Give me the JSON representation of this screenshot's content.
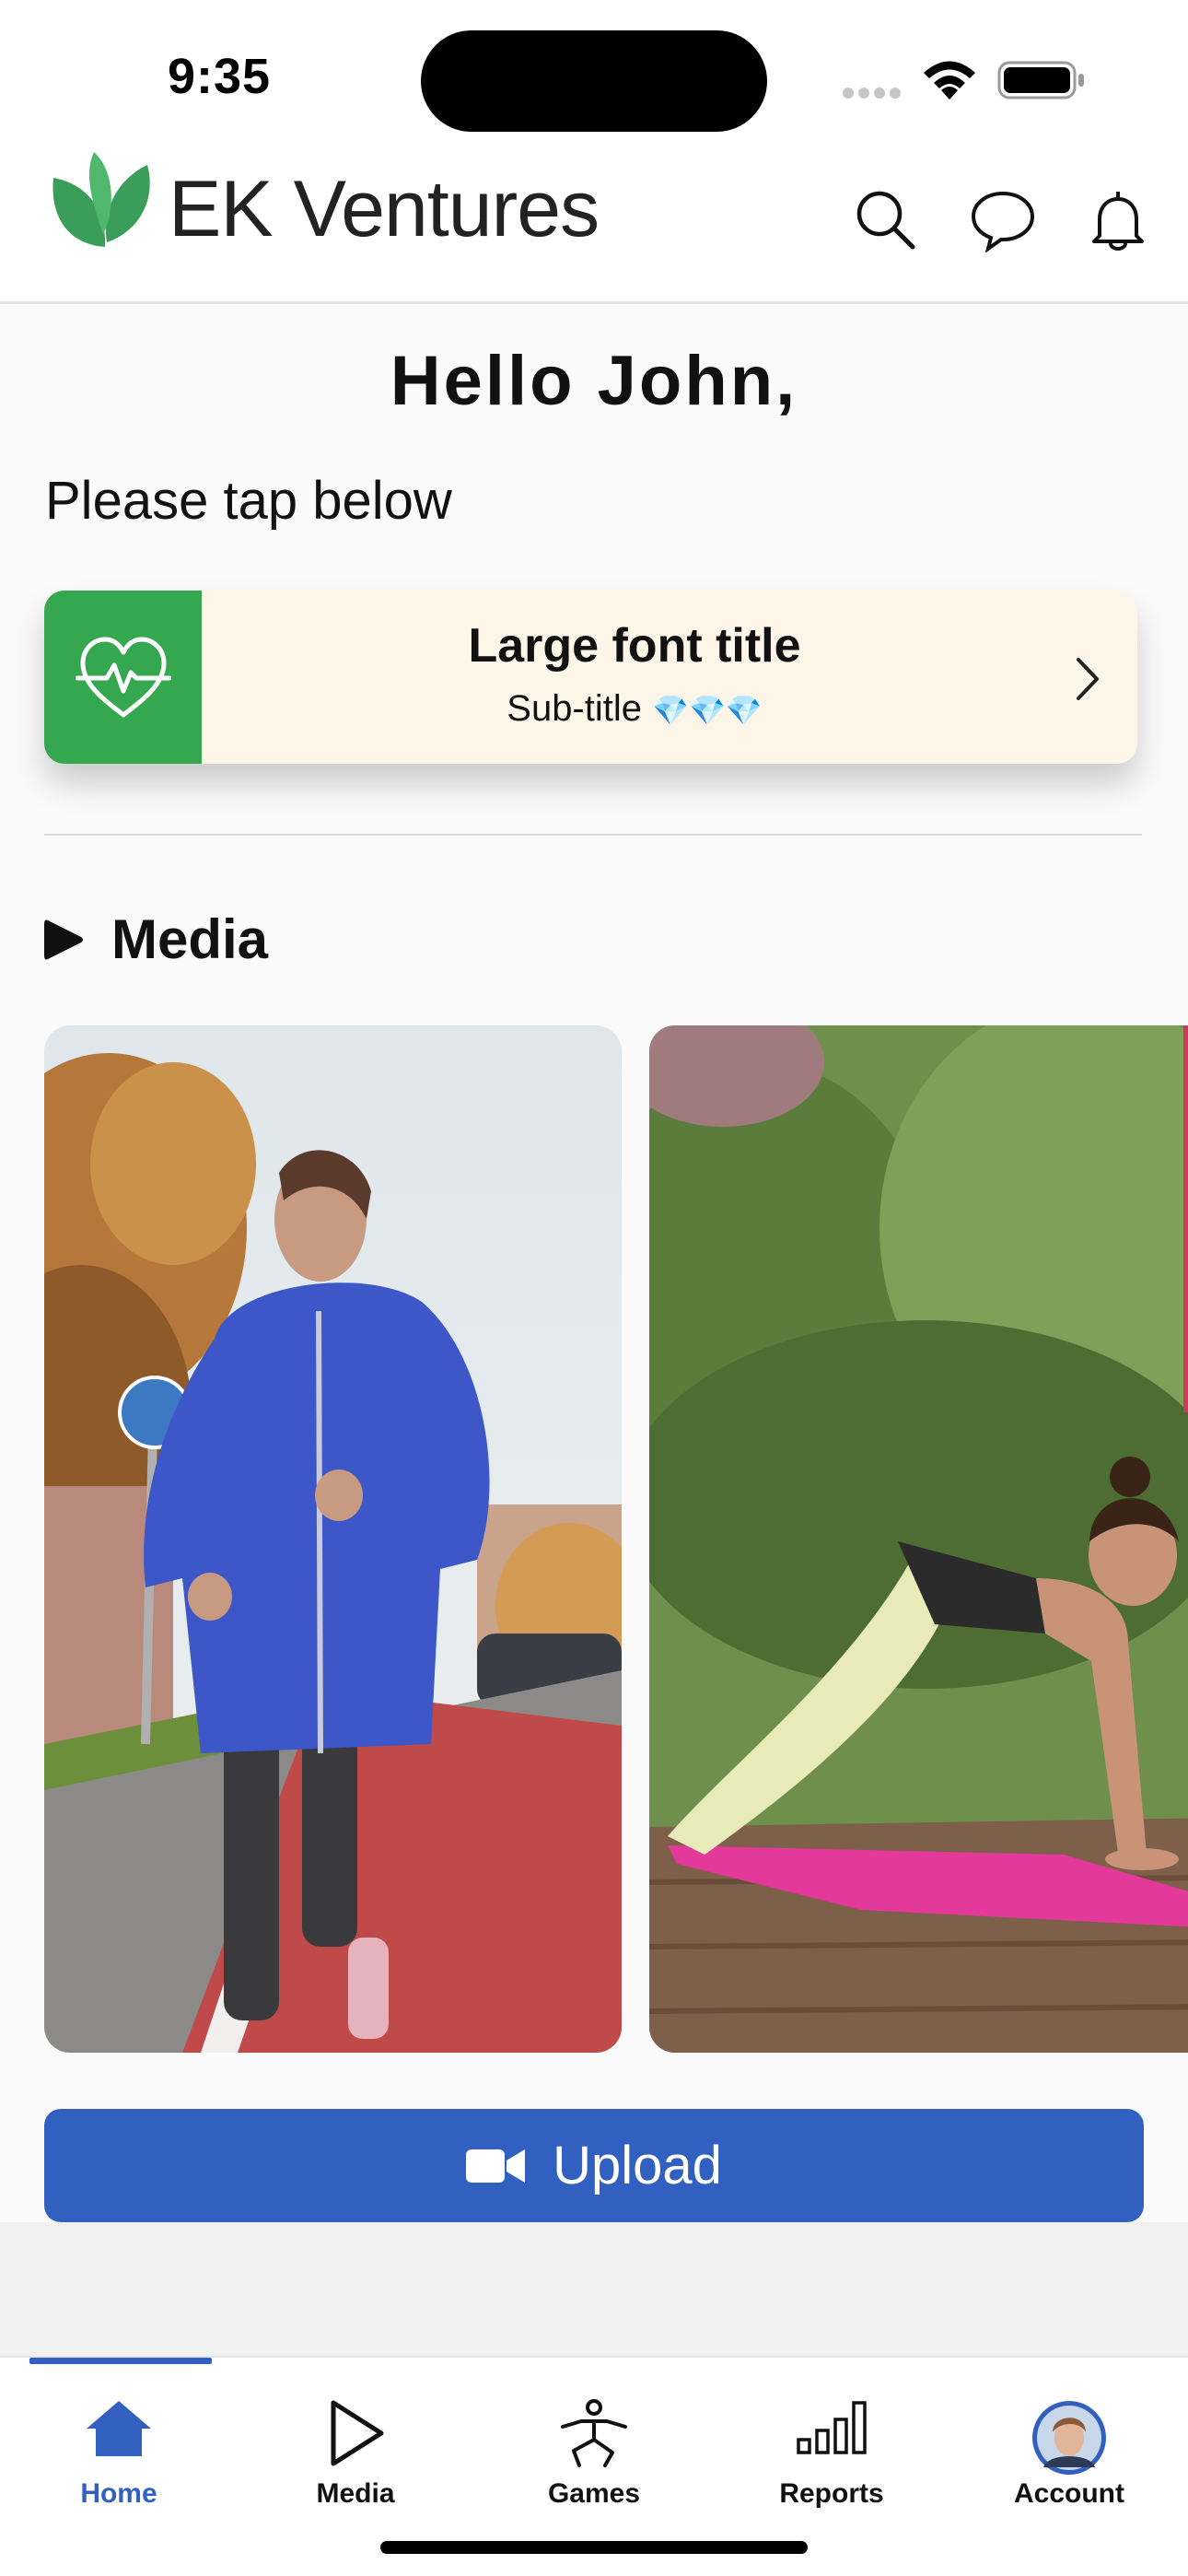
{
  "status_bar": {
    "time": "9:35"
  },
  "header": {
    "brand": "EK Ventures"
  },
  "greeting": "Hello John,",
  "prompt": "Please tap below",
  "card": {
    "title": "Large font title",
    "subtitle": "Sub-title",
    "badges": "💎💎💎"
  },
  "media": {
    "heading": "Media",
    "upload_label": "Upload"
  },
  "tabs": [
    {
      "label": "Home",
      "icon": "home-icon",
      "active": true
    },
    {
      "label": "Media",
      "icon": "play-icon",
      "active": false
    },
    {
      "label": "Games",
      "icon": "games-figure-icon",
      "active": false
    },
    {
      "label": "Reports",
      "icon": "bar-chart-icon",
      "active": false
    },
    {
      "label": "Account",
      "icon": "avatar",
      "active": false
    }
  ],
  "colors": {
    "accent": "#3160c0",
    "card_icon_bg": "#35a84f",
    "card_bg": "#fdf6e8",
    "logo_green": "#3a9e5a"
  }
}
